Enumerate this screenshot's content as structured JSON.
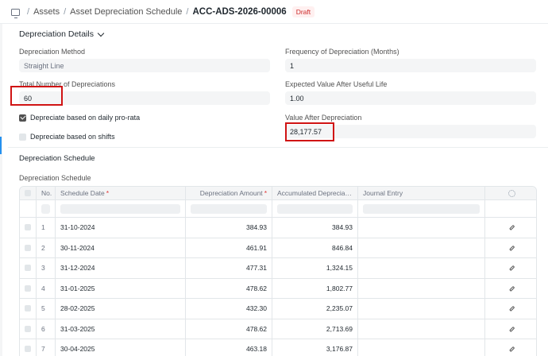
{
  "breadcrumb": {
    "items": [
      "Assets",
      "Asset Depreciation Schedule"
    ],
    "current": "ACC-ADS-2026-00006",
    "status": "Draft"
  },
  "details": {
    "section_title": "Depreciation Details",
    "method_label": "Depreciation Method",
    "method_value": "Straight Line",
    "frequency_label": "Frequency of Depreciation (Months)",
    "frequency_value": "1",
    "total_label": "Total Number of Depreciations",
    "total_value": "60",
    "expected_label": "Expected Value After Useful Life",
    "expected_value": "1.00",
    "daily_prorata_label": "Depreciate based on daily pro-rata",
    "daily_prorata_checked": true,
    "shifts_label": "Depreciate based on shifts",
    "shifts_checked": false,
    "vad_label": "Value After Depreciation",
    "vad_value": "28,177.57"
  },
  "schedule": {
    "section_title": "Depreciation Schedule",
    "table_label": "Depreciation Schedule",
    "columns": {
      "no": "No.",
      "date": "Schedule Date",
      "amount": "Depreciation Amount",
      "accumulated": "Accumulated Depreciation Amount",
      "journal": "Journal Entry"
    },
    "rows": [
      {
        "no": "1",
        "date": "31-10-2024",
        "amount": "384.93",
        "accumulated": "384.93",
        "journal": ""
      },
      {
        "no": "2",
        "date": "30-11-2024",
        "amount": "461.91",
        "accumulated": "846.84",
        "journal": ""
      },
      {
        "no": "3",
        "date": "31-12-2024",
        "amount": "477.31",
        "accumulated": "1,324.15",
        "journal": ""
      },
      {
        "no": "4",
        "date": "31-01-2025",
        "amount": "478.62",
        "accumulated": "1,802.77",
        "journal": ""
      },
      {
        "no": "5",
        "date": "28-02-2025",
        "amount": "432.30",
        "accumulated": "2,235.07",
        "journal": ""
      },
      {
        "no": "6",
        "date": "31-03-2025",
        "amount": "478.62",
        "accumulated": "2,713.69",
        "journal": ""
      },
      {
        "no": "7",
        "date": "30-04-2025",
        "amount": "463.18",
        "accumulated": "3,176.87",
        "journal": ""
      }
    ]
  },
  "colors": {
    "highlight": "#d01414",
    "draft_badge": "#cc2929",
    "required": "#e03636"
  },
  "icons": [
    "monitor-icon",
    "chevron-down-icon",
    "gear-icon",
    "pencil-icon"
  ]
}
